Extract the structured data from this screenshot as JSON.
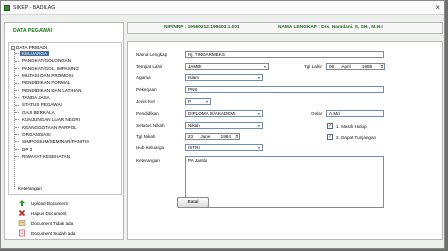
{
  "window": {
    "title": "SIKEP - BADILAG"
  },
  "sidebar": {
    "header": "DATA PEGAWAI",
    "root": "DATA PRIBADI",
    "items": [
      {
        "label": "KELUARGA",
        "selected": true
      },
      {
        "label": "PANGKAT/GOLONGAN"
      },
      {
        "label": "PANGKAT/GOL. IMPASING"
      },
      {
        "label": "MUTASI DAN PROMOSI"
      },
      {
        "label": "PENDIDIKAN FORMAL"
      },
      {
        "label": "PENDIDIKAN DAN LATIHAN"
      },
      {
        "label": "TANDA JASA"
      },
      {
        "label": "STATUS PEGAWAI"
      },
      {
        "label": "GAJI BERKALA"
      },
      {
        "label": "KUNJUNGAN LUAR NEGRI"
      },
      {
        "label": "KEANGGOTAAN PARPOL"
      },
      {
        "label": "ORGANISASI"
      },
      {
        "label": "SIMPOSIUM/SEMINAR/PANITIA"
      },
      {
        "label": "DP 3"
      },
      {
        "label": "RIWAYAT KESEHATAN"
      }
    ],
    "keterangan_label": "Keterangan",
    "keterangan": [
      {
        "text": "Upload Document",
        "icon": "upload-icon",
        "color": "#2a9a2a"
      },
      {
        "text": "Hapus Document",
        "icon": "delete-icon",
        "color": "#c42020"
      },
      {
        "text": "Document Tidak ada",
        "icon": "document-missing-icon",
        "color": "#c8a040"
      },
      {
        "text": "Document Sudah ada",
        "icon": "document-exists-icon",
        "color": "#d04040"
      }
    ]
  },
  "info": {
    "nip": "NIP/NRP : 19560212.198403.1.001",
    "nama": "NAMA LENGKAP : Drs. Hamdani. S, SH., M.H.I"
  },
  "form": {
    "nama_lengkap": {
      "label": "Nama Lengkap",
      "value": "Hj. TINDARMEKS"
    },
    "tempat_lahir": {
      "label": "Tempat Lahir",
      "value": "JAMBI"
    },
    "tgl_lahir": {
      "label": "Tgl Lahir",
      "day": "08",
      "month": "April",
      "year": "1958"
    },
    "agama": {
      "label": "Agama",
      "value": "Islam"
    },
    "pekerjaan": {
      "label": "Pekerjaan",
      "value": "PNS"
    },
    "jenis_kel": {
      "label": "Jenis Kel",
      "value": "P"
    },
    "pendidikan": {
      "label": "Pendidikan",
      "value": "DIPLOMA III/AKADEMI"
    },
    "gelar": {
      "label": "Gelar",
      "value": "A.Md"
    },
    "setatus_nikah": {
      "label": "Setatus Nikah",
      "value": "Nikah"
    },
    "tgl_nikah": {
      "label": "Tgl Nikah",
      "day": "23",
      "month": "June",
      "year": "1984"
    },
    "hub_keluarga": {
      "label": "Hub Keluarga",
      "value": "ISTRI"
    },
    "keterangan": {
      "label": "Keterangan",
      "value": "PA Jambi"
    },
    "masih_hidup": {
      "label": "1. Masih Hidup",
      "checked": true
    },
    "dapat_tunjangan": {
      "label": "2. Dapat Tunjangan",
      "checked": true
    },
    "batal_label": "Batal"
  },
  "colors": {
    "header_green": "#1e7a1e",
    "selection_blue": "#3a6ea5"
  }
}
